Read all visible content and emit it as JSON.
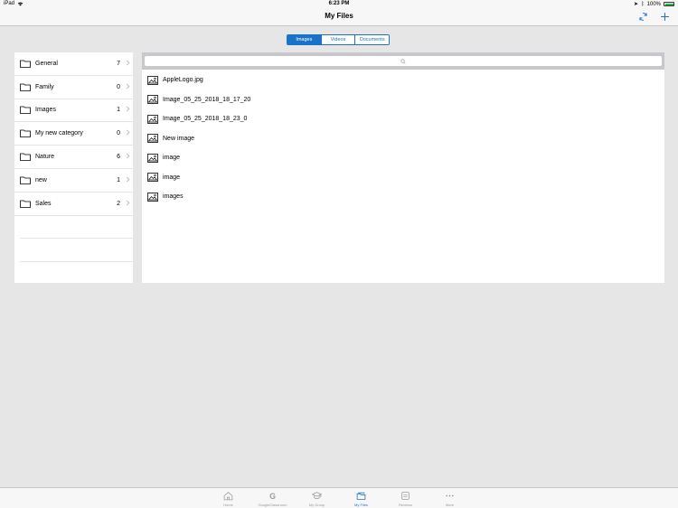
{
  "status_bar": {
    "device": "iPad",
    "time": "6:23 PM",
    "battery": "100%",
    "battery_level": 1.0
  },
  "nav": {
    "title": "My Files"
  },
  "segments": [
    {
      "label": "Images",
      "active": true
    },
    {
      "label": "Videos",
      "active": false
    },
    {
      "label": "Documents",
      "active": false
    }
  ],
  "categories": [
    {
      "label": "General",
      "count": "7"
    },
    {
      "label": "Family",
      "count": "0"
    },
    {
      "label": "Images",
      "count": "1"
    },
    {
      "label": "My new category",
      "count": "0"
    },
    {
      "label": "Nature",
      "count": "6"
    },
    {
      "label": "new",
      "count": "1"
    },
    {
      "label": "Sales",
      "count": "2"
    }
  ],
  "files": [
    {
      "name": "AppleLogo.jpg"
    },
    {
      "name": "Image_05_25_2018_18_17_20"
    },
    {
      "name": "Image_05_25_2018_18_23_0"
    },
    {
      "name": "New image"
    },
    {
      "name": "image"
    },
    {
      "name": "image"
    },
    {
      "name": "images"
    }
  ],
  "tabs": [
    {
      "label": "Home",
      "icon": "home-icon",
      "active": false
    },
    {
      "label": "GoogleClassroom",
      "icon": "google-icon",
      "active": false
    },
    {
      "label": "My Group",
      "icon": "graduation-cap-icon",
      "active": false
    },
    {
      "label": "My Files",
      "icon": "files-icon",
      "active": true
    },
    {
      "label": "Reviews",
      "icon": "reviews-icon",
      "active": false
    },
    {
      "label": "More",
      "icon": "more-icon",
      "active": false
    }
  ],
  "colors": {
    "accent": "#1a73c8",
    "battery": "#2fb24a"
  }
}
